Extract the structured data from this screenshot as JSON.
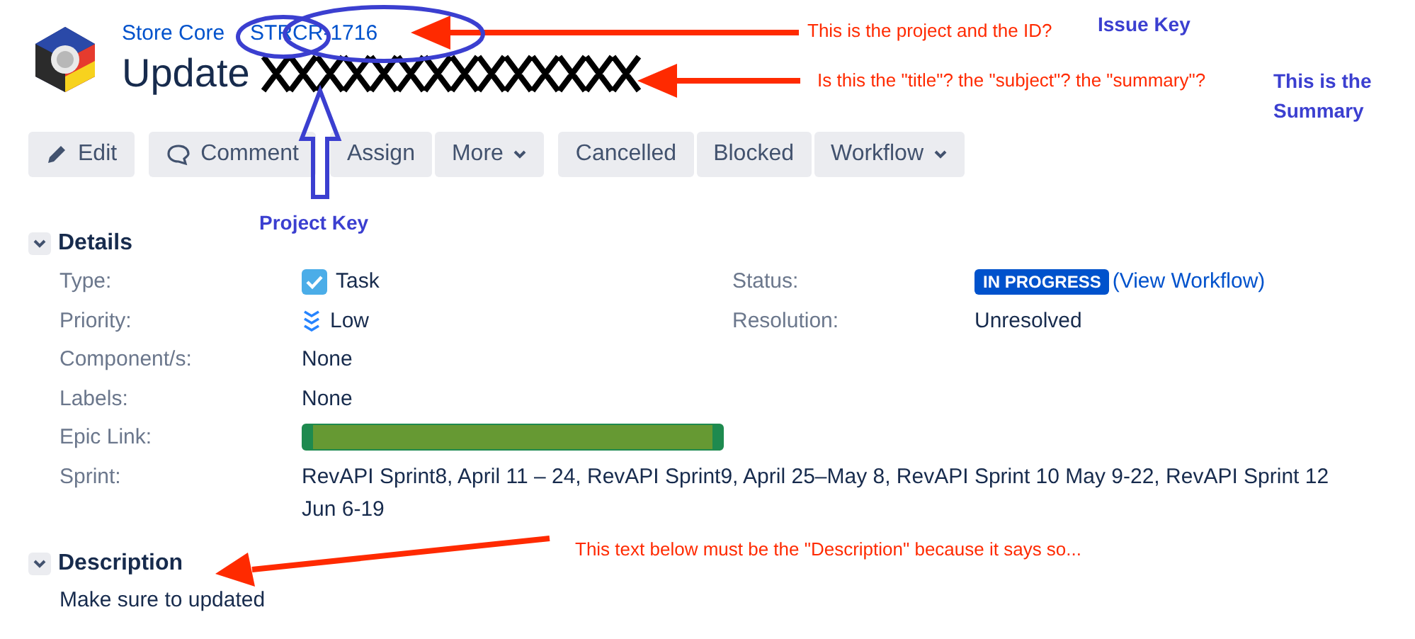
{
  "breadcrumb": {
    "project": "Store Core",
    "issue_key": "STRCR-1716"
  },
  "summary": {
    "text": "Update",
    "redacted": true
  },
  "button_groups": [
    [
      {
        "label": "Edit",
        "kind": "edit"
      }
    ],
    [
      {
        "label": "Comment",
        "kind": "comment"
      }
    ],
    [
      {
        "label": "Assign",
        "kind": "plain"
      },
      {
        "label": "More",
        "kind": "menu"
      }
    ],
    [
      {
        "label": "Cancelled",
        "kind": "plain"
      },
      {
        "label": "Blocked",
        "kind": "plain"
      },
      {
        "label": "Workflow",
        "kind": "menu"
      }
    ]
  ],
  "details": {
    "title": "Details",
    "expanded": true,
    "fields_left": [
      {
        "label": "Type:",
        "kind": "type",
        "value": "Task"
      },
      {
        "label": "Priority:",
        "kind": "priority",
        "value": "Low"
      },
      {
        "label": "Component/s:",
        "kind": "text",
        "value": "None"
      },
      {
        "label": "Labels:",
        "kind": "text",
        "value": "None"
      },
      {
        "label": "Epic Link:",
        "kind": "redacted"
      },
      {
        "label": "Sprint:",
        "kind": "wide",
        "value": "RevAPI Sprint8, April 11 – 24, RevAPI Sprint9, April 25–May 8, RevAPI Sprint 10 May 9-22, RevAPI Sprint 12 Jun 6-19"
      }
    ],
    "fields_right": [
      {
        "label": "Status:",
        "kind": "status",
        "value": "IN PROGRESS",
        "link": "(View Workflow)"
      },
      {
        "label": "Resolution:",
        "kind": "text",
        "value": "Unresolved"
      }
    ]
  },
  "description": {
    "title": "Description",
    "expanded": true,
    "text": "Make sure to updated"
  },
  "annotations": [
    {
      "kind": "note",
      "text": "This is the project and the ID?",
      "color": "#ff2a00"
    },
    {
      "kind": "label",
      "text": "Issue Key",
      "color": "#3b3fd0"
    },
    {
      "kind": "note",
      "text": "Is this the \"title\"? the \"subject\"? the \"summary\"?",
      "color": "#ff2a00"
    },
    {
      "kind": "label",
      "text": "This is the Summary",
      "color": "#3b3fd0"
    },
    {
      "kind": "label",
      "text": "Project Key",
      "color": "#3b3fd0"
    },
    {
      "kind": "note",
      "text": "This text below must be the \"Description\" because it says so...",
      "color": "#ff2a00"
    }
  ]
}
